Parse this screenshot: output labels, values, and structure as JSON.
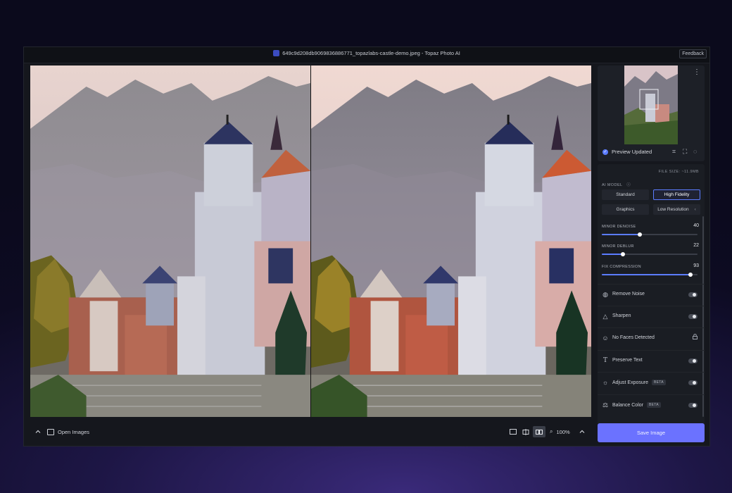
{
  "window": {
    "title": "649c9d208db9069836886771_topazlabs-castle-demo.jpeg - Topaz Photo AI",
    "feedback_label": "Feedback"
  },
  "bottom_bar": {
    "open_images_label": "Open Images",
    "zoom": "100%"
  },
  "preview": {
    "status": "Preview Updated"
  },
  "settings": {
    "file_size": "FILE SIZE: ~11.9MB",
    "ai_model_label": "AI MODEL",
    "models": [
      "Standard",
      "High Fidelity",
      "Graphics",
      "Low Resolution"
    ],
    "selected_model": "High Fidelity",
    "sliders": [
      {
        "label": "MINOR DENOISE",
        "value": 40,
        "max": 100
      },
      {
        "label": "MINOR DEBLUR",
        "value": 22,
        "max": 100
      },
      {
        "label": "FIX COMPRESSION",
        "value": 93,
        "max": 100
      }
    ]
  },
  "features": [
    {
      "label": "Remove Noise",
      "icon": "noise-icon",
      "control": "toggle",
      "enabled": false
    },
    {
      "label": "Sharpen",
      "icon": "triangle-icon",
      "control": "toggle",
      "enabled": false
    },
    {
      "label": "No Faces Detected",
      "icon": "face-icon",
      "control": "lock"
    },
    {
      "label": "Preserve Text",
      "icon": "text-icon",
      "control": "toggle",
      "enabled": false
    },
    {
      "label": "Adjust Exposure",
      "icon": "sun-icon",
      "control": "toggle",
      "badge": "BETA",
      "enabled": false
    },
    {
      "label": "Balance Color",
      "icon": "color-icon",
      "control": "toggle",
      "badge": "BETA",
      "enabled": false
    }
  ],
  "save_label": "Save Image",
  "colors": {
    "accent": "#5b7cff",
    "save": "#6b72ff",
    "bg": "#15171d"
  }
}
